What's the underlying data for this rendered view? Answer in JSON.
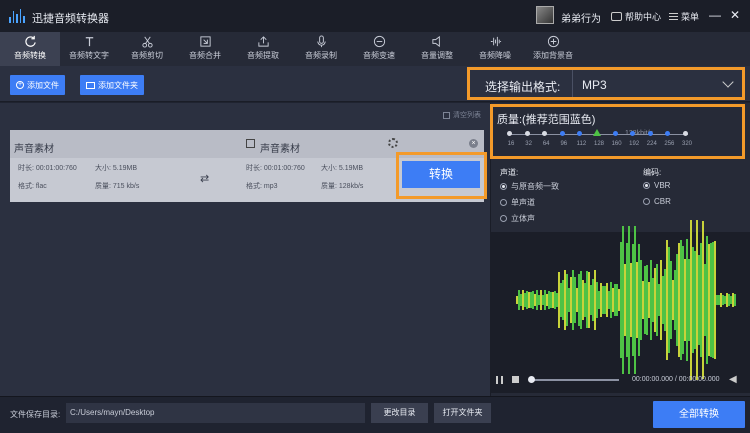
{
  "titlebar": {
    "app_title": "迅捷音频转换器",
    "username": "弟弟行为",
    "help_label": "帮助中心",
    "menu_label": "菜单",
    "minimize": "—",
    "close": "✕"
  },
  "toolbar": {
    "items": [
      {
        "label": "音频转换",
        "icon": "refresh-icon"
      },
      {
        "label": "音频转文字",
        "icon": "text-icon"
      },
      {
        "label": "音频剪切",
        "icon": "scissors-icon"
      },
      {
        "label": "音频合并",
        "icon": "merge-icon"
      },
      {
        "label": "音频提取",
        "icon": "extract-icon"
      },
      {
        "label": "音频录制",
        "icon": "mic-icon"
      },
      {
        "label": "音频变速",
        "icon": "speed-icon"
      },
      {
        "label": "音量调整",
        "icon": "volume-icon"
      },
      {
        "label": "音频降噪",
        "icon": "denoise-icon"
      },
      {
        "label": "添加背景音",
        "icon": "add-music-icon"
      }
    ]
  },
  "actions": {
    "add_file": "添加文件",
    "add_folder": "添加文件夹"
  },
  "format": {
    "label": "选择输出格式:",
    "value": "MP3"
  },
  "list": {
    "clear_label": "清空列表"
  },
  "file": {
    "source_title": "声音素材",
    "target_title": "声音素材",
    "src_duration": "时长: 00:01:00:760",
    "src_size": "大小: 5.19MB",
    "src_format": "格式: flac",
    "src_quality": "质量: 715 kb/s",
    "dst_duration": "时长: 00:01:00:760",
    "dst_size": "大小: 5.19MB",
    "dst_format": "格式: mp3",
    "dst_quality": "质量: 128kb/s",
    "convert_label": "转换"
  },
  "quality": {
    "title": "质量:(推荐范围蓝色)",
    "unit": "128kbit/s",
    "ticks": [
      "16",
      "32",
      "64",
      "96",
      "112",
      "128",
      "160",
      "192",
      "224",
      "256",
      "320"
    ],
    "selected": "128"
  },
  "channel": {
    "label": "声道:",
    "options": [
      "与原音频一致",
      "单声道",
      "立体声"
    ],
    "selected": "与原音频一致"
  },
  "encoding": {
    "label": "编码:",
    "options": [
      "VBR",
      "CBR"
    ],
    "selected": "VBR"
  },
  "player": {
    "time": "00:00:00.000 / 00:00:00.000"
  },
  "footer": {
    "save_label": "文件保存目录:",
    "path": "C:/Users/mayn/Desktop",
    "change_dir": "更改目录",
    "open_folder": "打开文件夹",
    "convert_all": "全部转换"
  },
  "colors": {
    "accent": "#3d7df5",
    "highlight": "#f39a2a",
    "wave_green": "#4ec245",
    "wave_yellow": "#c8d23a"
  }
}
